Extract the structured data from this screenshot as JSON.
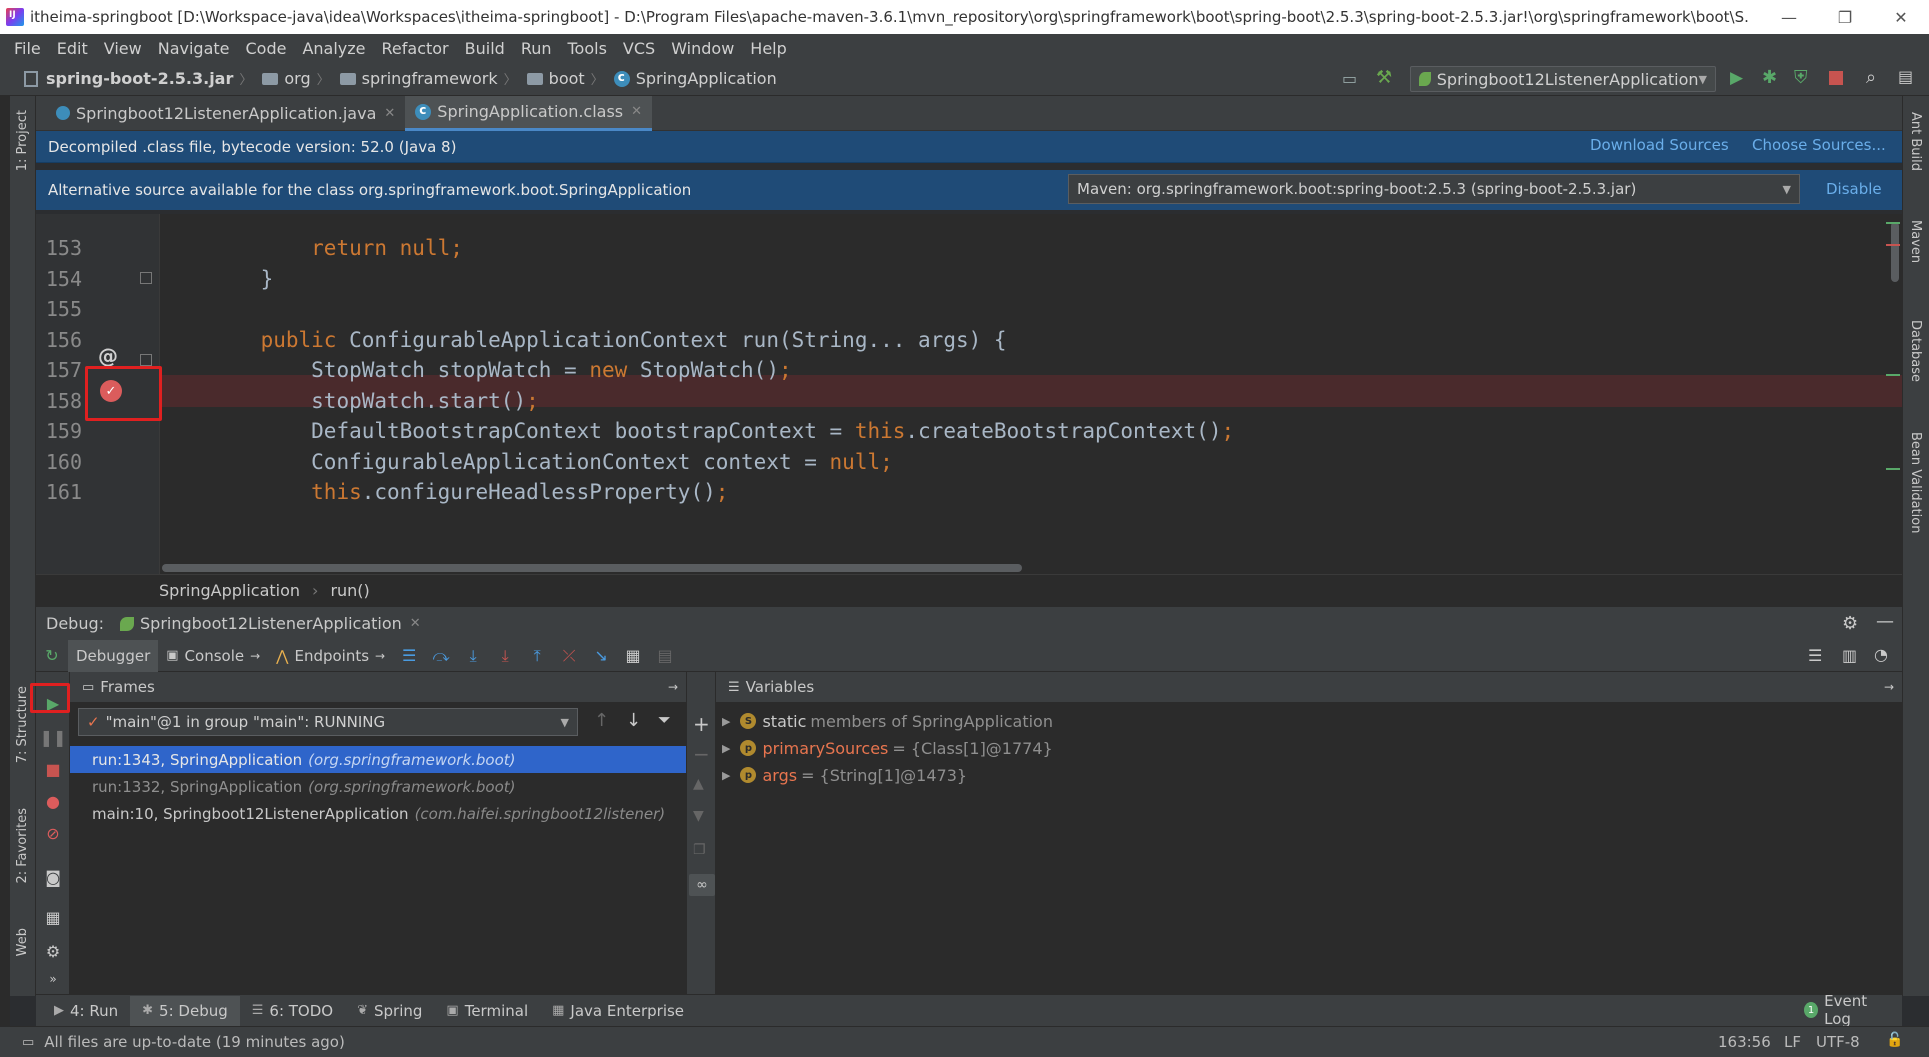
{
  "window": {
    "title": "itheima-springboot [D:\\Workspace-java\\idea\\Workspaces\\itheima-springboot] - D:\\Program Files\\apache-maven-3.6.1\\mvn_repository\\org\\springframework\\boot\\spring-boot\\2.5.3\\spring-boot-2.5.3.jar!\\org\\springframework\\boot\\S...",
    "minimize": "—",
    "restore": "❐",
    "close": "✕"
  },
  "menu": [
    "File",
    "Edit",
    "View",
    "Navigate",
    "Code",
    "Analyze",
    "Refactor",
    "Build",
    "Run",
    "Tools",
    "VCS",
    "Window",
    "Help"
  ],
  "navbar": {
    "crumbs": [
      "spring-boot-2.5.3.jar",
      "org",
      "springframework",
      "boot",
      "SpringApplication"
    ],
    "run_config": "Springboot12ListenerApplication"
  },
  "editor_tabs": [
    {
      "label": "Springboot12ListenerApplication.java",
      "active": false
    },
    {
      "label": "SpringApplication.class",
      "active": true
    }
  ],
  "banner": {
    "decompiled": "Decompiled .class file, bytecode version: 52.0 (Java 8)",
    "download_sources": "Download Sources",
    "choose_sources": "Choose Sources...",
    "alt_source": "Alternative source available for the class org.springframework.boot.SpringApplication",
    "maven_source": "Maven: org.springframework.boot:spring-boot:2.5.3 (spring-boot-2.5.3.jar)",
    "disable": "Disable"
  },
  "code": {
    "lines": [
      {
        "num": "153",
        "indent": "        ",
        "tokens": [
          {
            "t": "return null",
            "k": true
          },
          {
            "t": ";",
            "k": true
          }
        ]
      },
      {
        "num": "154",
        "indent": "    ",
        "tokens": [
          {
            "t": "}",
            "k": false
          }
        ]
      },
      {
        "num": "155",
        "indent": "",
        "tokens": []
      },
      {
        "num": "156",
        "indent": "    ",
        "tokens": [
          {
            "t": "public ",
            "k": true
          },
          {
            "t": "ConfigurableApplicationContext run(String... args) {",
            "k": false
          }
        ]
      },
      {
        "num": "157",
        "indent": "        ",
        "tokens": [
          {
            "t": "StopWatch stopWatch = ",
            "k": false
          },
          {
            "t": "new ",
            "k": true
          },
          {
            "t": "StopWatch()",
            "k": false
          },
          {
            "t": ";",
            "k": true
          }
        ]
      },
      {
        "num": "158",
        "indent": "        ",
        "tokens": [
          {
            "t": "stopWatch.start()",
            "k": false
          },
          {
            "t": ";",
            "k": true
          }
        ]
      },
      {
        "num": "159",
        "indent": "        ",
        "tokens": [
          {
            "t": "DefaultBootstrapContext bootstrapContext = ",
            "k": false
          },
          {
            "t": "this",
            "k": true
          },
          {
            "t": ".createBootstrapContext()",
            "k": false
          },
          {
            "t": ";",
            "k": true
          }
        ]
      },
      {
        "num": "160",
        "indent": "        ",
        "tokens": [
          {
            "t": "ConfigurableApplicationContext context = ",
            "k": false
          },
          {
            "t": "null",
            "k": true
          },
          {
            "t": ";",
            "k": true
          }
        ]
      },
      {
        "num": "161",
        "indent": "        ",
        "tokens": [
          {
            "t": "this",
            "k": true
          },
          {
            "t": ".configureHeadlessProperty()",
            "k": false
          },
          {
            "t": ";",
            "k": true
          }
        ]
      }
    ]
  },
  "editor_crumbs": [
    "SpringApplication",
    "run()"
  ],
  "debug": {
    "label": "Debug:",
    "session": "Springboot12ListenerApplication",
    "tabs": [
      "Debugger",
      "Console",
      "Endpoints"
    ],
    "frames_title": "Frames",
    "variables_title": "Variables",
    "thread": "\"main\"@1 in group \"main\": RUNNING",
    "frames": [
      {
        "method": "run:1343, SpringApplication",
        "pkg": "(org.springframework.boot)",
        "state": "selected"
      },
      {
        "method": "run:1332, SpringApplication",
        "pkg": "(org.springframework.boot)",
        "state": "dim"
      },
      {
        "method": "main:10, Springboot12ListenerApplication",
        "pkg": "(com.haifei.springboot12listener)",
        "state": "normal"
      }
    ],
    "variables": [
      {
        "badge": "S",
        "prefix": "static",
        "name": "members of SpringApplication",
        "value": "",
        "static": true
      },
      {
        "badge": "p",
        "prefix": "",
        "name": "primarySources",
        "value": "= {Class[1]@1774}",
        "static": false
      },
      {
        "badge": "p",
        "prefix": "",
        "name": "args",
        "value": "= {String[1]@1473}",
        "static": false
      }
    ]
  },
  "left_tools": [
    "1: Project",
    "7: Structure",
    "2: Favorites",
    "Web"
  ],
  "right_tools": [
    "Ant Build",
    "Maven",
    "Database",
    "Bean Validation"
  ],
  "bottom_tabs": [
    {
      "label": "4: Run",
      "active": false
    },
    {
      "label": "5: Debug",
      "active": true
    },
    {
      "label": "6: TODO",
      "active": false
    },
    {
      "label": "Spring",
      "active": false
    },
    {
      "label": "Terminal",
      "active": false
    },
    {
      "label": "Java Enterprise",
      "active": false
    }
  ],
  "event_log": "Event Log",
  "event_count": "1",
  "status": {
    "message": "All files are up-to-date (19 minutes ago)",
    "position": "163:56",
    "line_sep": "LF",
    "encoding": "UTF-8"
  }
}
